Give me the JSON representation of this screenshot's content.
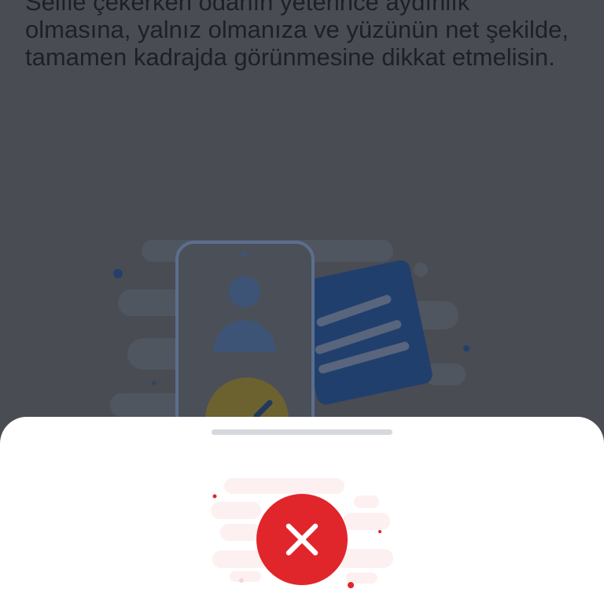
{
  "page": {
    "description_lines": [
      "Selfie çekerken odanın yeterince aydınlık",
      "olmasına, yalnız olmanıza ve yüzünün net şekilde,",
      "tamamen kadrajda görünmesine dikkat etmelisin."
    ],
    "illustration": "selfie-with-id-document-illustration"
  },
  "bottom_sheet": {
    "status_icon": "error-x-icon"
  },
  "colors": {
    "backdrop": "#494c53",
    "text": "#1e2025",
    "sheet_background": "#ffffff",
    "handle": "#d5d8dd",
    "error_red": "#e0262b",
    "document_blue": "#213f6d",
    "check_yellow": "#6c6230"
  }
}
